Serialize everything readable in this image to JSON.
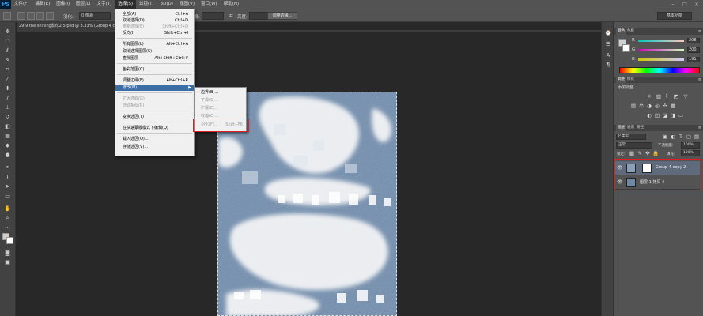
{
  "app": {
    "logo": "Ps"
  },
  "menubar": {
    "items": [
      {
        "label": "文件(F)"
      },
      {
        "label": "编辑(E)"
      },
      {
        "label": "图像(I)"
      },
      {
        "label": "图层(L)"
      },
      {
        "label": "文字(Y)"
      },
      {
        "label": "选择(S)"
      },
      {
        "label": "滤镜(T)"
      },
      {
        "label": "3D(D)"
      },
      {
        "label": "视图(V)"
      },
      {
        "label": "窗口(W)"
      },
      {
        "label": "帮助(H)"
      }
    ],
    "window_controls": [
      "–",
      "□",
      "×"
    ]
  },
  "options_bar": {
    "feather_label": "羽化:",
    "feather_value": "0 像素",
    "width_label": "宽度:",
    "height_label": "高度:",
    "refine_edge_button": "调整边缘...",
    "workspace": "基本功能"
  },
  "document": {
    "tab_title": "29-9 the shining影印2.5.psd @ 8.33% (Group 4 copy 2, RGB/8#)"
  },
  "select_menu": {
    "items": [
      {
        "label": "全部(A)",
        "shortcut": "Ctrl+A",
        "disabled": false
      },
      {
        "label": "取消选择(D)",
        "shortcut": "Ctrl+D",
        "disabled": false
      },
      {
        "label": "重新选择(E)",
        "shortcut": "Shift+Ctrl+D",
        "disabled": true
      },
      {
        "label": "反向(I)",
        "shortcut": "Shift+Ctrl+I",
        "disabled": false
      },
      {
        "label": "所有图层(L)",
        "shortcut": "Alt+Ctrl+A",
        "disabled": false
      },
      {
        "label": "取消选择图层(S)",
        "shortcut": "",
        "disabled": false
      },
      {
        "label": "查找图层",
        "shortcut": "Alt+Shift+Ctrl+F",
        "disabled": false
      },
      {
        "label": "色彩范围(C)...",
        "shortcut": "",
        "disabled": false
      },
      {
        "label": "调整边缘(F)...",
        "shortcut": "Alt+Ctrl+R",
        "disabled": false
      },
      {
        "label": "修改(M)",
        "shortcut": "",
        "disabled": false
      },
      {
        "label": "扩大选取(G)",
        "shortcut": "",
        "disabled": true
      },
      {
        "label": "选取相似(R)",
        "shortcut": "",
        "disabled": true
      },
      {
        "label": "变换选区(T)",
        "shortcut": "",
        "disabled": false
      },
      {
        "label": "在快速蒙版模式下编辑(Q)",
        "shortcut": "",
        "disabled": false
      },
      {
        "label": "载入选区(O)...",
        "shortcut": "",
        "disabled": false
      },
      {
        "label": "存储选区(V)...",
        "shortcut": "",
        "disabled": false
      }
    ]
  },
  "modify_submenu": {
    "items": [
      {
        "label": "边界(B)...",
        "shortcut": "",
        "disabled": false
      },
      {
        "label": "平滑(S)...",
        "shortcut": "",
        "disabled": true
      },
      {
        "label": "扩展(E)...",
        "shortcut": "",
        "disabled": true
      },
      {
        "label": "收缩(C)...",
        "shortcut": "",
        "disabled": true
      },
      {
        "label": "羽化(F)...",
        "shortcut": "Shift+F6",
        "disabled": true
      }
    ]
  },
  "color_panel": {
    "tabs": [
      "颜色",
      "色板"
    ],
    "channels": [
      {
        "label": "R",
        "value": "208"
      },
      {
        "label": "G",
        "value": "200"
      },
      {
        "label": "B",
        "value": "191"
      }
    ]
  },
  "adjustments_panel": {
    "tabs": [
      "调整",
      "样式"
    ],
    "title": "添加调整"
  },
  "layers_panel": {
    "tabs": [
      "图层",
      "通道",
      "路径"
    ],
    "filter_kind": "P 类型",
    "blend_mode": "正常",
    "opacity_label": "不透明度:",
    "opacity_value": "100%",
    "lock_label": "锁定:",
    "fill_label": "填充:",
    "fill_value": "100%",
    "layers": [
      {
        "name": "Group 4 copy 2",
        "selected": true
      },
      {
        "name": "图层 1 拷贝 4",
        "selected": false
      }
    ]
  },
  "colors": {
    "accent_highlight": "#3b6ea5",
    "annotation_red": "#e02020"
  }
}
